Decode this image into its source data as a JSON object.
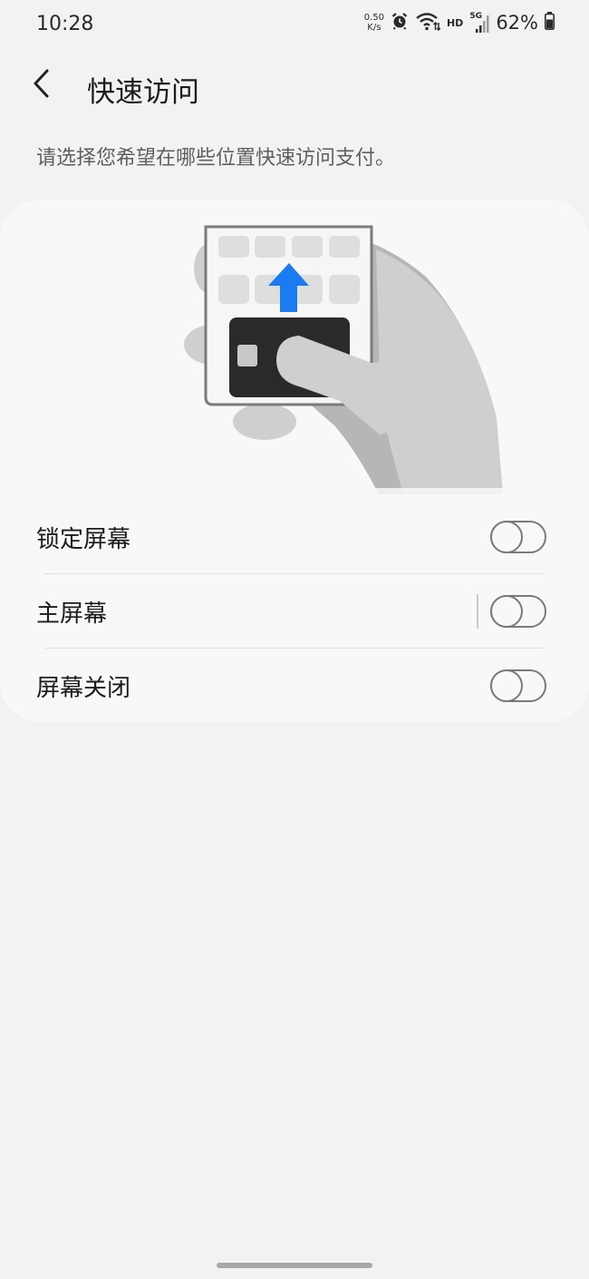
{
  "status_bar": {
    "time": "10:28",
    "net_speed_value": "0.50",
    "net_speed_unit": "K/s",
    "hd_label": "HD",
    "network_type": "5G",
    "battery_percent": "62%",
    "icons": [
      "alarm-icon",
      "wifi-icon",
      "cell-signal-icon",
      "battery-icon"
    ]
  },
  "header": {
    "back_icon": "chevron-left-icon",
    "title": "快速访问"
  },
  "description": "请选择您希望在哪些位置快速访问支付。",
  "illustration": {
    "icons": [
      "phone-icon",
      "up-arrow-icon",
      "payment-card-icon",
      "hand-icon"
    ],
    "arrow_color": "#1a7cf0",
    "card_color": "#2a2a2a"
  },
  "options": [
    {
      "label": "锁定屏幕",
      "enabled": false
    },
    {
      "label": "主屏幕",
      "enabled": false
    },
    {
      "label": "屏幕关闭",
      "enabled": false
    }
  ]
}
